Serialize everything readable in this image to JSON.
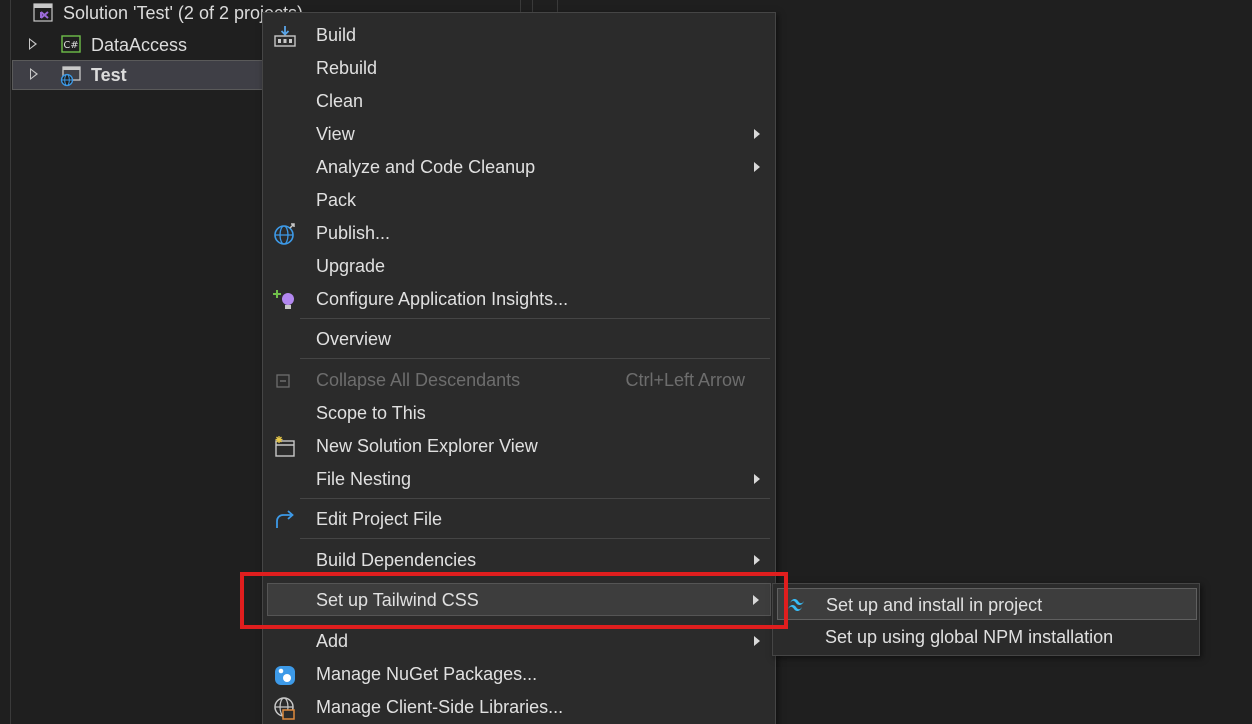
{
  "solution_explorer": {
    "solution_label": "Solution 'Test' (2 of 2 projects)",
    "projects": [
      {
        "name": "DataAccess",
        "icon": "csharp-project-icon"
      },
      {
        "name": "Test",
        "icon": "web-project-icon",
        "selected": true
      }
    ]
  },
  "context_menu": {
    "items": [
      {
        "label": "Build",
        "icon": "build-icon"
      },
      {
        "label": "Rebuild"
      },
      {
        "label": "Clean"
      },
      {
        "label": "View",
        "submenu": true
      },
      {
        "label": "Analyze and Code Cleanup",
        "submenu": true
      },
      {
        "label": "Pack"
      },
      {
        "label": "Publish...",
        "icon": "globe-publish-icon"
      },
      {
        "label": "Upgrade"
      },
      {
        "label": "Configure Application Insights...",
        "icon": "lightbulb-add-icon"
      },
      {
        "label": "Overview"
      },
      {
        "label": "Collapse All Descendants",
        "shortcut": "Ctrl+Left Arrow",
        "disabled": true,
        "icon": "collapse-icon"
      },
      {
        "label": "Scope to This"
      },
      {
        "label": "New Solution Explorer View",
        "icon": "new-window-icon"
      },
      {
        "label": "File Nesting",
        "submenu": true
      },
      {
        "label": "Edit Project File",
        "icon": "redo-arrow-icon"
      },
      {
        "label": "Build Dependencies",
        "submenu": true
      },
      {
        "label": "Set up Tailwind CSS",
        "submenu": true,
        "highlighted": true
      },
      {
        "label": "Add",
        "submenu": true
      },
      {
        "label": "Manage NuGet Packages...",
        "icon": "nuget-icon"
      },
      {
        "label": "Manage Client-Side Libraries...",
        "icon": "client-libraries-icon"
      }
    ]
  },
  "tailwind_submenu": {
    "items": [
      {
        "label": "Set up and install in project",
        "icon": "tailwind-icon",
        "highlighted": true
      },
      {
        "label": "Set up using global NPM installation"
      }
    ]
  },
  "colors": {
    "background": "#1f1f1f",
    "menu_background": "#2b2b2b",
    "highlight_border": "#e01e1e",
    "csharp_green": "#6fbf4a",
    "vs_purple": "#9c6ad8",
    "globe_blue": "#3d9ae8",
    "tailwind_cyan": "#38bdf8"
  }
}
